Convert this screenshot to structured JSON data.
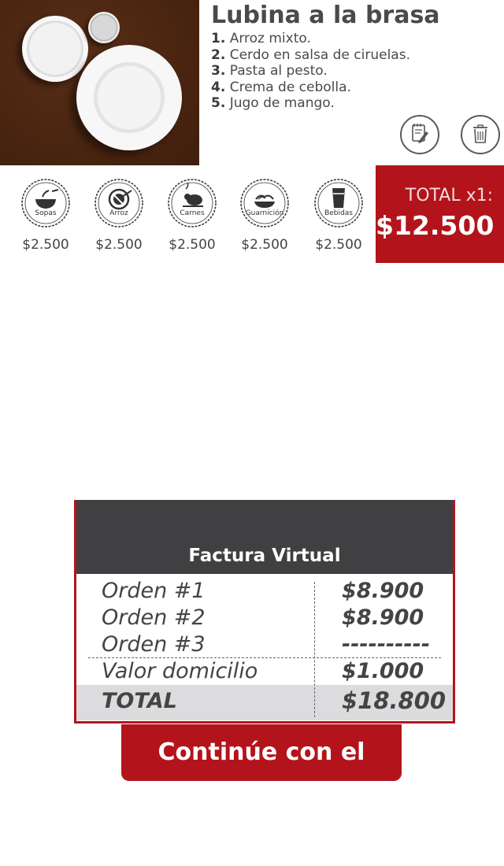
{
  "dish": {
    "title": "Lubina a la brasa",
    "items": [
      {
        "num": "1.",
        "text": "Arroz mixto."
      },
      {
        "num": "2.",
        "text": "Cerdo en salsa de ciruelas."
      },
      {
        "num": "3.",
        "text": "Pasta al pesto."
      },
      {
        "num": "4.",
        "text": "Crema de cebolla."
      },
      {
        "num": "5.",
        "text": "Jugo de mango."
      }
    ]
  },
  "actions": {
    "edit_icon": "edit-note-icon",
    "delete_icon": "trash-icon"
  },
  "categories": [
    {
      "label": "Sopas",
      "price": "$2.500",
      "icon": "soup-bowl-icon"
    },
    {
      "label": "Arroz",
      "price": "$2.500",
      "icon": "rice-plate-icon"
    },
    {
      "label": "Carnes",
      "price": "$2.500",
      "icon": "roast-chicken-icon"
    },
    {
      "label": "Guarnición",
      "price": "$2.500",
      "icon": "pasta-bowl-icon"
    },
    {
      "label": "Bebidas",
      "price": "$2.500",
      "icon": "drink-cup-icon"
    }
  ],
  "total": {
    "label": "TOTAL x1:",
    "value": "$12.500"
  },
  "invoice": {
    "title": "Factura Virtual",
    "rows": [
      {
        "label": "Orden #1",
        "value": "$8.900"
      },
      {
        "label": "Orden #2",
        "value": "$8.900"
      },
      {
        "label": "Orden #3",
        "value": "----------"
      },
      {
        "label": "Valor domicilio",
        "value": "$1.000"
      }
    ],
    "total_label": "TOTAL",
    "total_value": "$18.800"
  },
  "pay_button": "Continúe con el pago",
  "colors": {
    "accent": "#b3141b",
    "header": "#404042",
    "text": "#4a4a4a"
  }
}
